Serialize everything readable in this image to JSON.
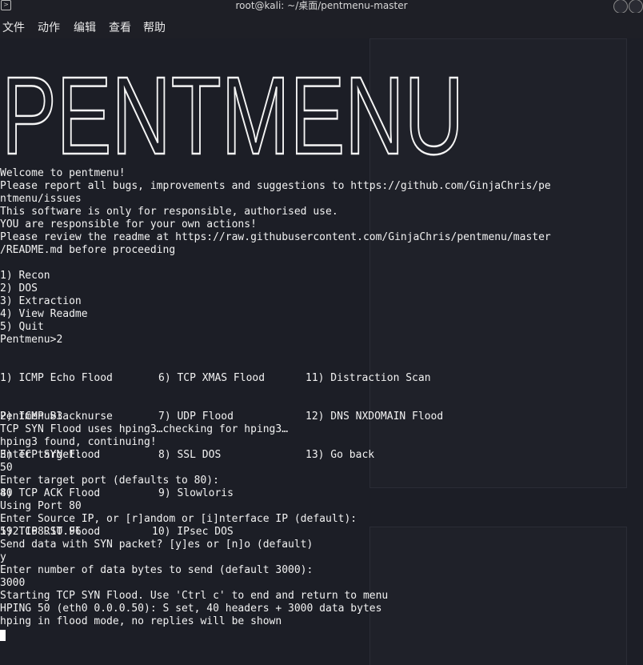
{
  "window": {
    "title": "root@kali: ~/桌面/pentmenu-master"
  },
  "menubar": {
    "items": [
      "文件",
      "动作",
      "编辑",
      "查看",
      "帮助"
    ]
  },
  "banner": {
    "text": "PENTMENU"
  },
  "terminal": {
    "lines": [
      "Welcome to pentmenu!",
      "Please report all bugs, improvements and suggestions to https://github.com/GinjaChris/pe",
      "ntmenu/issues",
      "This software is only for responsible, authorised use.",
      "YOU are responsible for your own actions!",
      "Please review the readme at https://raw.githubusercontent.com/GinjaChris/pentmenu/master",
      "/README.md before proceeding",
      "",
      "1) Recon",
      "2) DOS",
      "3) Extraction",
      "4) View Readme",
      "5) Quit",
      "Pentmenu>2"
    ],
    "dos_menu": {
      "col1": [
        "1) ICMP Echo Flood",
        "2) ICMP Blacknurse",
        "3) TCP SYN Flood",
        "4) TCP ACK Flood",
        "5) TCP RST Flood"
      ],
      "col2": [
        "6) TCP XMAS Flood",
        "7) UDP Flood",
        "8) SSL DOS",
        "9) Slowloris",
        "10) IPsec DOS"
      ],
      "col3": [
        "11) Distraction Scan",
        "12) DNS NXDOMAIN Flood",
        "13) Go back"
      ]
    },
    "lines2": [
      "Pentmenu>3",
      "TCP SYN Flood uses hping3…checking for hping3…",
      "hping3 found, continuing!",
      "Enter target:",
      "50",
      "Enter target port (defaults to 80):",
      "80",
      "Using Port 80",
      "Enter Source IP, or [r]andom or [i]nterface IP (default):",
      "192.168.10.96",
      "Send data with SYN packet? [y]es or [n]o (default)",
      "y",
      "Enter number of data bytes to send (default 3000):",
      "3000",
      "Starting TCP SYN Flood. Use 'Ctrl c' to end and return to menu",
      "HPING 50 (eth0 0.0.0.50): S set, 40 headers + 3000 data bytes",
      "hping in flood mode, no replies will be shown"
    ]
  },
  "colors": {
    "background": "#1c1e26",
    "text": "#f2f2f2",
    "banner": "#f4f4f4"
  }
}
